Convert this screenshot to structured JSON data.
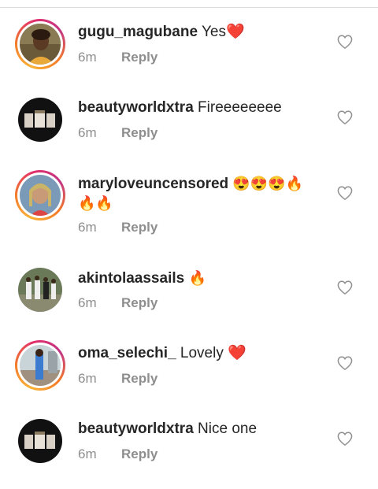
{
  "comments": [
    {
      "username": "gugu_magubane",
      "text": "Yes❤️",
      "time": "6m",
      "reply": "Reply",
      "story_ring": true
    },
    {
      "username": "beautyworldxtra",
      "text": "Fireeeeeeee",
      "time": "6m",
      "reply": "Reply",
      "story_ring": false
    },
    {
      "username": "maryloveuncensored",
      "text": "😍😍😍🔥",
      "text_line2": "🔥🔥",
      "time": "6m",
      "reply": "Reply",
      "story_ring": true
    },
    {
      "username": "akintolaassails",
      "text": "🔥",
      "time": "6m",
      "reply": "Reply",
      "story_ring": false
    },
    {
      "username": "oma_selechi_",
      "text": "Lovely ❤️",
      "time": "6m",
      "reply": "Reply",
      "story_ring": true
    },
    {
      "username": "beautyworldxtra",
      "text": "Nice one",
      "time": "6m",
      "reply": "Reply",
      "story_ring": false
    }
  ],
  "colors": {
    "text_primary": "#262626",
    "text_secondary": "#8e8e8e",
    "ring_gradient": [
      "#f9b234",
      "#e1306c",
      "#c13584"
    ]
  },
  "icons": {
    "like": "heart-outline-icon"
  }
}
